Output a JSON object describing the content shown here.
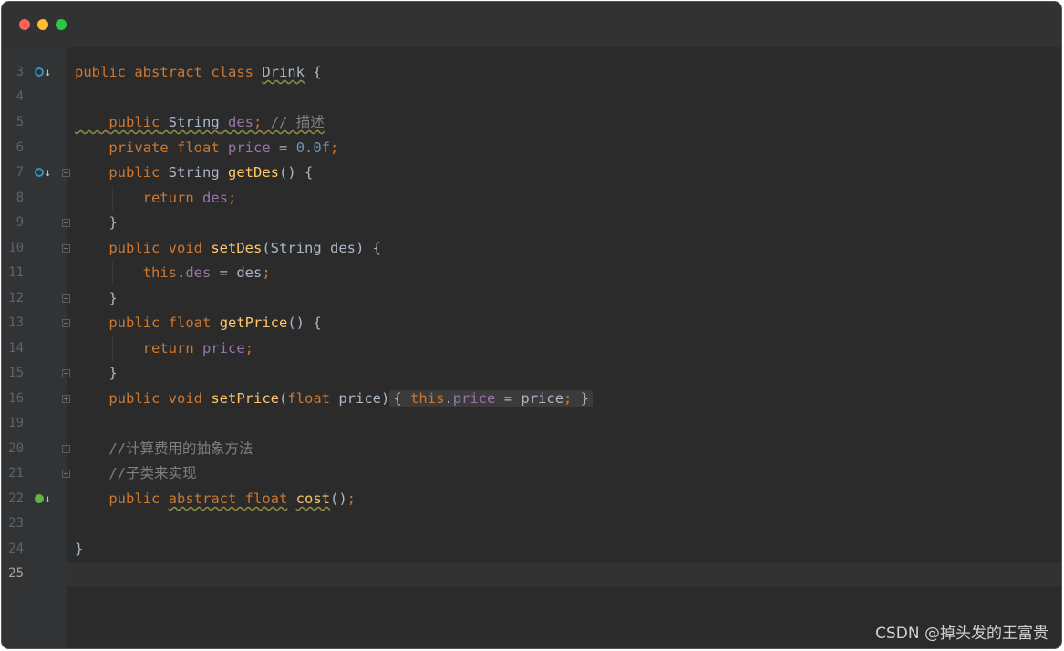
{
  "window": {
    "controls": [
      "close",
      "minimize",
      "maximize"
    ]
  },
  "lines": [
    {
      "num": "3",
      "marker": "override-blue",
      "fold": "",
      "current": false
    },
    {
      "num": "4",
      "marker": "",
      "fold": "",
      "current": false
    },
    {
      "num": "5",
      "marker": "",
      "fold": "",
      "current": false
    },
    {
      "num": "6",
      "marker": "",
      "fold": "",
      "current": false
    },
    {
      "num": "7",
      "marker": "override-blue",
      "fold": "open",
      "current": false
    },
    {
      "num": "8",
      "marker": "",
      "fold": "",
      "current": false
    },
    {
      "num": "9",
      "marker": "",
      "fold": "close",
      "current": false
    },
    {
      "num": "10",
      "marker": "",
      "fold": "open",
      "current": false
    },
    {
      "num": "11",
      "marker": "",
      "fold": "",
      "current": false
    },
    {
      "num": "12",
      "marker": "",
      "fold": "close",
      "current": false
    },
    {
      "num": "13",
      "marker": "",
      "fold": "open",
      "current": false
    },
    {
      "num": "14",
      "marker": "",
      "fold": "",
      "current": false
    },
    {
      "num": "15",
      "marker": "",
      "fold": "close",
      "current": false
    },
    {
      "num": "16",
      "marker": "",
      "fold": "plus",
      "current": false
    },
    {
      "num": "19",
      "marker": "",
      "fold": "",
      "current": false
    },
    {
      "num": "20",
      "marker": "",
      "fold": "open",
      "current": false
    },
    {
      "num": "21",
      "marker": "",
      "fold": "close",
      "current": false
    },
    {
      "num": "22",
      "marker": "implement-green",
      "fold": "",
      "current": false
    },
    {
      "num": "23",
      "marker": "",
      "fold": "",
      "current": false
    },
    {
      "num": "24",
      "marker": "",
      "fold": "",
      "current": false
    },
    {
      "num": "25",
      "marker": "",
      "fold": "",
      "current": true
    }
  ],
  "code": {
    "l3": {
      "kw1": "public",
      "kw2": "abstract",
      "kw3": "class",
      "name": "Drink",
      "brace": " {"
    },
    "l5": {
      "kw": "public",
      "type": "String",
      "field": "des",
      "semi": ";",
      "comment": "// 描述"
    },
    "l6": {
      "kw1": "private",
      "kw2": "float",
      "field": "price",
      "eq": " = ",
      "num": "0.0f",
      "semi": ";"
    },
    "l7": {
      "kw": "public",
      "type": "String",
      "fn": "getDes",
      "rest": "() {"
    },
    "l8": {
      "kw": "return",
      "field": "des",
      "semi": ";"
    },
    "l9": {
      "text": "}"
    },
    "l10": {
      "kw1": "public",
      "kw2": "void",
      "fn": "setDes",
      "rest": "(String des) {"
    },
    "l11": {
      "kw": "this",
      "dot": ".",
      "field": "des",
      "rest": " = des",
      "semi": ";"
    },
    "l12": {
      "text": "}"
    },
    "l13": {
      "kw1": "public",
      "kw2": "float",
      "fn": "getPrice",
      "rest": "() {"
    },
    "l14": {
      "kw": "return",
      "field": "price",
      "semi": ";"
    },
    "l15": {
      "text": "}"
    },
    "l16": {
      "kw1": "public",
      "kw2": "void",
      "fn": "setPrice",
      "p1": "(",
      "kw3": "float",
      "p2": " price)",
      "ob": "{",
      "kw4": "this",
      "dot": ".",
      "field": "price",
      "rest": " = price",
      "semi": ";",
      "cb": "}"
    },
    "l20": {
      "comment": "//计算费用的抽象方法"
    },
    "l21": {
      "comment": "//子类来实现"
    },
    "l22": {
      "kw1": "public",
      "kw2": "abstract float",
      "fn": "cost",
      "rest": "()",
      "semi": ";"
    },
    "l24": {
      "text": "}"
    }
  },
  "watermark": "CSDN @掉头发的王富贵",
  "colors": {
    "keyword": "#cc7832",
    "function": "#ffc66d",
    "field": "#9876aa",
    "number": "#6897bb",
    "comment": "#808080",
    "text": "#a9b7c6",
    "background": "#2b2b2b"
  }
}
